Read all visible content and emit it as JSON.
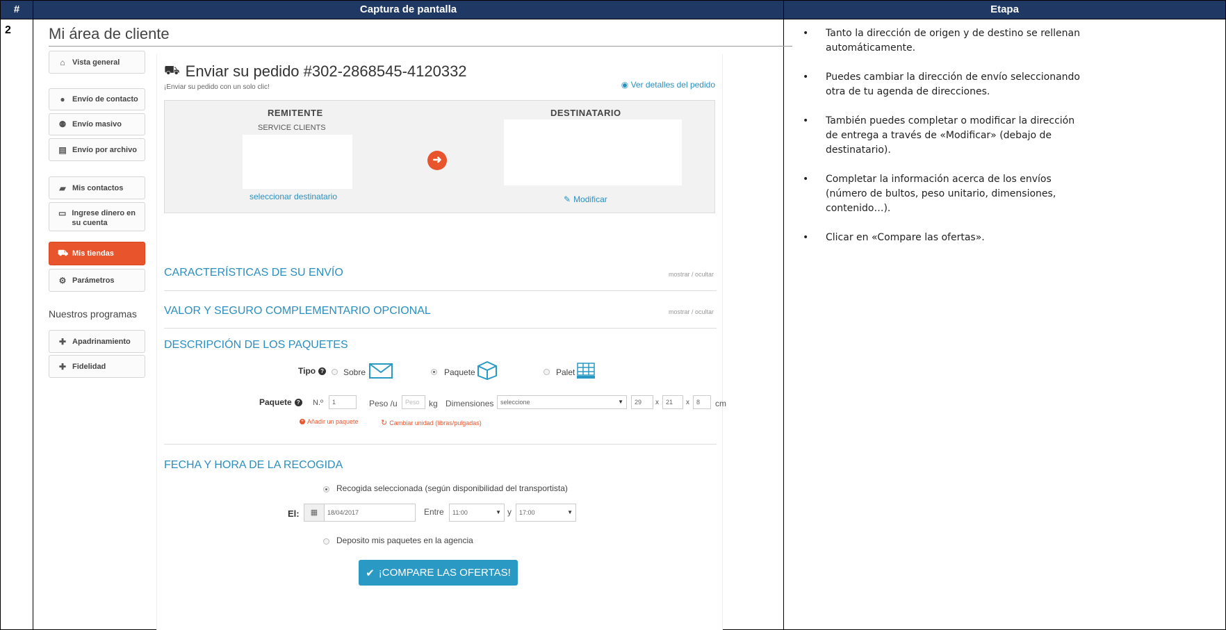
{
  "table": {
    "headers": [
      "#",
      "Captura de pantalla",
      "Etapa"
    ],
    "row_number": "2"
  },
  "screenshot": {
    "area_title": "Mi área de cliente",
    "sidebar": {
      "items": [
        {
          "icon": "home-icon",
          "label": "Vista general"
        },
        {
          "icon": "user-icon",
          "label": "Envío de contacto"
        },
        {
          "icon": "users-icon",
          "label": "Envío masivo"
        },
        {
          "icon": "file-icon",
          "label": "Envío por archivo"
        },
        {
          "icon": "book-icon",
          "label": "Mis contactos"
        },
        {
          "icon": "card-icon",
          "label": "Ingrese dinero en su cuenta"
        },
        {
          "icon": "cart-icon",
          "label": "Mis tiendas"
        },
        {
          "icon": "gears-icon",
          "label": "Parámetros"
        }
      ],
      "programs_heading": "Nuestros programas",
      "programs": [
        {
          "icon": "gift-icon",
          "label": "Apadrinamiento"
        },
        {
          "icon": "gift-icon",
          "label": "Fidelidad"
        }
      ]
    },
    "order": {
      "title": "Enviar su pedido #302-2868545-4120332",
      "subtitle": "¡Enviar su pedido con un solo clic!",
      "view_details": "Ver detalles del pedido"
    },
    "addresses": {
      "sender_heading": "REMITENTE",
      "sender_name": "SERVICE CLIENTS",
      "select_recipient": "seleccionar destinatario",
      "recipient_heading": "DESTINATARIO",
      "modify": "Modificar"
    },
    "sections": {
      "characteristics": "CARACTERÍSTICAS DE SU ENVÍO",
      "value_insurance": "VALOR Y SEGURO COMPLEMENTARIO OPCIONAL",
      "toggle": "mostrar / ocultar",
      "packages": "DESCRIPCIÓN DE LOS PAQUETES",
      "pickup": "FECHA Y HORA DE LA RECOGIDA"
    },
    "package_form": {
      "type_label": "Tipo",
      "types": [
        "Sobre",
        "Paquete",
        "Palet"
      ],
      "selected_type": "Paquete",
      "package_label": "Paquete",
      "number_prefix": "N.º",
      "number_value": "1",
      "weight_label": "Peso /u",
      "weight_placeholder": "Peso",
      "weight_unit": "kg",
      "dimensions_label": "Dimensiones",
      "dimensions_select": "seleccione",
      "length": "29",
      "width": "21",
      "height": "8",
      "times": "x",
      "dim_unit": "cm",
      "add_package": "Añadir un paquete",
      "change_unit": "Cambiar unidad (libras/pulgadas)"
    },
    "pickup_form": {
      "option_selected": "Recogida seleccionada (según disponibilidad del transportista)",
      "date_label": "El:",
      "date_value": "18/04/2017",
      "between_label": "Entre",
      "from_time": "11:00",
      "and_label": "y",
      "to_time": "17:00",
      "option_agency": "Deposito mis paquetes en la agencia"
    },
    "compare_button": "¡COMPARE LAS OFERTAS!",
    "colors": {
      "accent_orange": "#e8542c",
      "accent_blue": "#2a9ac4",
      "header_navy": "#1f3864"
    }
  },
  "steps": [
    "Tanto la dirección de origen y de destino se rellenan automáticamente.",
    "Puedes cambiar la dirección de envío seleccionando otra de tu agenda de direcciones.",
    "También puedes completar o modificar la dirección de entrega a través de «Modificar» (debajo de destinatario).",
    "Completar la información acerca de los envíos (número de bultos, peso unitario, dimensiones, contenido…).",
    "Clicar en «Compare las ofertas»."
  ]
}
